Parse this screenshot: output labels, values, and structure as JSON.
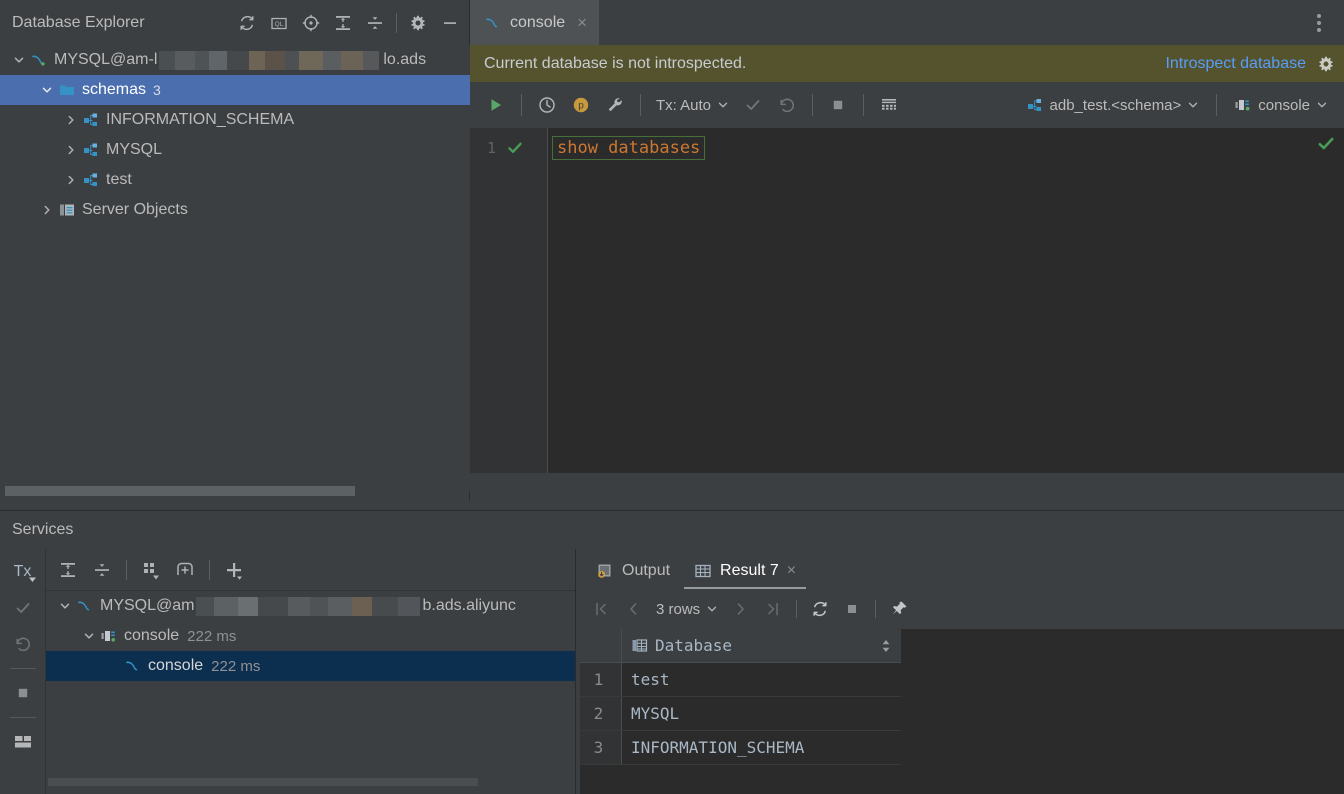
{
  "explorer": {
    "title": "Database Explorer",
    "toolbar": [
      {
        "name": "refresh-icon",
        "tip": "Refresh"
      },
      {
        "name": "ql-console-icon",
        "tip": "QL"
      },
      {
        "name": "scroll-from-source-icon",
        "tip": "Scroll from Source"
      },
      {
        "name": "expand-all-icon",
        "tip": "Expand All"
      },
      {
        "name": "collapse-all-icon",
        "tip": "Collapse All"
      },
      {
        "name": "settings-gear-icon",
        "tip": "Settings"
      },
      {
        "name": "minimize-icon",
        "tip": "Hide"
      }
    ],
    "tree": [
      {
        "label": "MYSQL@am-l",
        "suffix": "lo.ads",
        "redacted": true,
        "depth": 0,
        "icon": "mysql-dolphin-icon",
        "expanded": true,
        "selected": false,
        "count": ""
      },
      {
        "label": "schemas",
        "depth": 1,
        "icon": "folder-icon",
        "expanded": true,
        "selected": true,
        "count": "3"
      },
      {
        "label": "INFORMATION_SCHEMA",
        "depth": 2,
        "icon": "schema-icon",
        "expanded": false,
        "selected": false,
        "count": ""
      },
      {
        "label": "MYSQL",
        "depth": 2,
        "icon": "schema-icon",
        "expanded": false,
        "selected": false,
        "count": ""
      },
      {
        "label": "test",
        "depth": 2,
        "icon": "schema-icon",
        "expanded": false,
        "selected": false,
        "count": ""
      },
      {
        "label": "Server Objects",
        "depth": 1,
        "icon": "server-objects-icon",
        "expanded": false,
        "selected": false,
        "count": ""
      }
    ]
  },
  "editor": {
    "tab": {
      "label": "console",
      "icon": "mysql-dolphin-icon",
      "close": "×"
    },
    "kebab": "more-options-icon",
    "notification": {
      "message": "Current database is not introspected.",
      "link": "Introspect database",
      "gear": "settings-gear-icon",
      "background": "#54532e",
      "link_color": "#589df6"
    },
    "toolbar": {
      "execute": "run-icon",
      "history": "history-icon",
      "profile": "profiler-icon",
      "wrench": "settings-wrench-icon",
      "tx_label": "Tx: Auto",
      "commit": "commit-check-icon",
      "rollback": "rollback-icon",
      "stop": "stop-icon",
      "grid": "data-grid-icon",
      "schema_label": "adb_test.<schema>",
      "schema_icon": "schema-icon",
      "session_label": "console",
      "session_icon": "session-icon"
    },
    "code": {
      "line_number": "1",
      "text": "show databases",
      "status_ok": "inspection-ok-icon",
      "gutter_check": "statement-ok-icon",
      "text_color": "#cc7832",
      "box_border": "#45703c"
    }
  },
  "services": {
    "title": "Services",
    "rail": [
      {
        "name": "tx-mode-button",
        "label": "Tx"
      },
      {
        "name": "commit-button",
        "label": ""
      },
      {
        "name": "rollback-button",
        "label": ""
      },
      {
        "name": "stop-button",
        "label": ""
      },
      {
        "name": "layout-button",
        "label": ""
      }
    ],
    "toolbar": [
      {
        "name": "expand-all-icon"
      },
      {
        "name": "collapse-all-icon"
      },
      {
        "name": "group-by-icon"
      },
      {
        "name": "add-frame-icon"
      },
      {
        "name": "add-icon"
      }
    ],
    "tree": [
      {
        "label": "MYSQL@am",
        "suffix": "b.ads.aliyunc",
        "redacted": true,
        "depth": 0,
        "icon": "mysql-dolphin-icon",
        "expanded": true,
        "selected": false,
        "time": ""
      },
      {
        "label": "console",
        "depth": 1,
        "icon": "session-icon",
        "expanded": true,
        "selected": false,
        "time": "222 ms"
      },
      {
        "label": "console",
        "depth": 2,
        "icon": "mysql-dolphin-icon",
        "expanded": false,
        "selected": true,
        "time": "222 ms"
      }
    ]
  },
  "results": {
    "tabs": [
      {
        "label": "Output",
        "icon": "output-icon",
        "active": false,
        "closable": false
      },
      {
        "label": "Result 7",
        "icon": "result-grid-icon",
        "active": true,
        "closable": true,
        "close": "×"
      }
    ],
    "toolbar": {
      "first_page": "first-page-icon",
      "prev_page": "prev-page-icon",
      "rows_label": "3 rows",
      "next_page": "next-page-icon",
      "last_page": "last-page-icon",
      "reload": "reload-icon",
      "stop": "stop-icon",
      "pin": "pin-icon"
    },
    "grid": {
      "columns": [
        "Database"
      ],
      "row_numbers": [
        "1",
        "2",
        "3"
      ],
      "rows": [
        [
          "test"
        ],
        [
          "MYSQL"
        ],
        [
          "INFORMATION_SCHEMA"
        ]
      ]
    }
  }
}
